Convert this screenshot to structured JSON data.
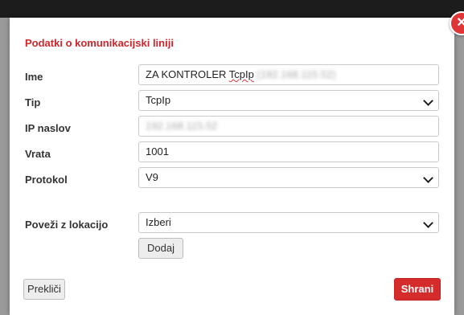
{
  "dialog": {
    "title": "Podatki o komunikacijski liniji",
    "close_icon": "close-icon",
    "close_glyph": "✕"
  },
  "form": {
    "name_label": "Ime",
    "name_value_visible": "ZA KONTROLER ",
    "name_value_spell": "TcpIp",
    "name_value_blurred": "(192.168.115.52)",
    "type_label": "Tip",
    "type_value": "TcpIp",
    "ip_label": "IP naslov",
    "ip_value_blurred": "192.168.115.52",
    "port_label": "Vrata",
    "port_value": "1001",
    "protocol_label": "Protokol",
    "protocol_value": "V9",
    "location_label": "Poveži z lokacijo",
    "location_value": "Izberi",
    "add_label": "Dodaj"
  },
  "footer": {
    "cancel_label": "Prekliči",
    "save_label": "Shrani"
  },
  "colors": {
    "accent": "#d0252b",
    "save_button": "#d62b2b",
    "close_button": "#e03536",
    "topbar": "#1c1c1c"
  }
}
